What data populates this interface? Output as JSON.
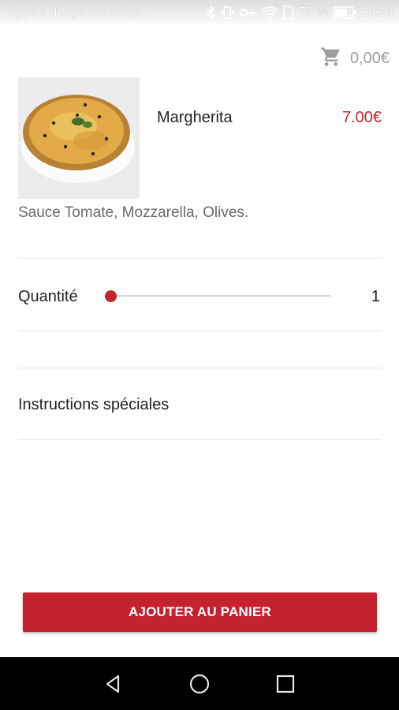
{
  "status_bar": {
    "carrier": "Appels d'urgence uniqu...",
    "battery": "73 %",
    "time": "18:16",
    "icons": [
      "bluetooth-icon",
      "vibrate-icon",
      "key-icon",
      "wifi-icon",
      "sim-icon",
      "battery-icon"
    ]
  },
  "cart": {
    "icon": "cart-icon",
    "total": "0,00€"
  },
  "product": {
    "image": "pizza-image",
    "name": "Margherita",
    "price": "7.00€",
    "description": "Sauce Tomate, Mozzarella, Olives."
  },
  "quantity": {
    "label": "Quantité",
    "value": "1",
    "slider_fraction": 0
  },
  "instructions": {
    "label": "Instructions spéciales"
  },
  "add_button": {
    "label": "AJOUTER AU PANIER"
  },
  "nav_bar": {
    "icons": [
      "back-icon",
      "home-icon",
      "recents-icon"
    ]
  },
  "colors": {
    "accent": "#c4242b",
    "muted_text": "#6b6b6b",
    "divider": "#e4e4e4"
  }
}
